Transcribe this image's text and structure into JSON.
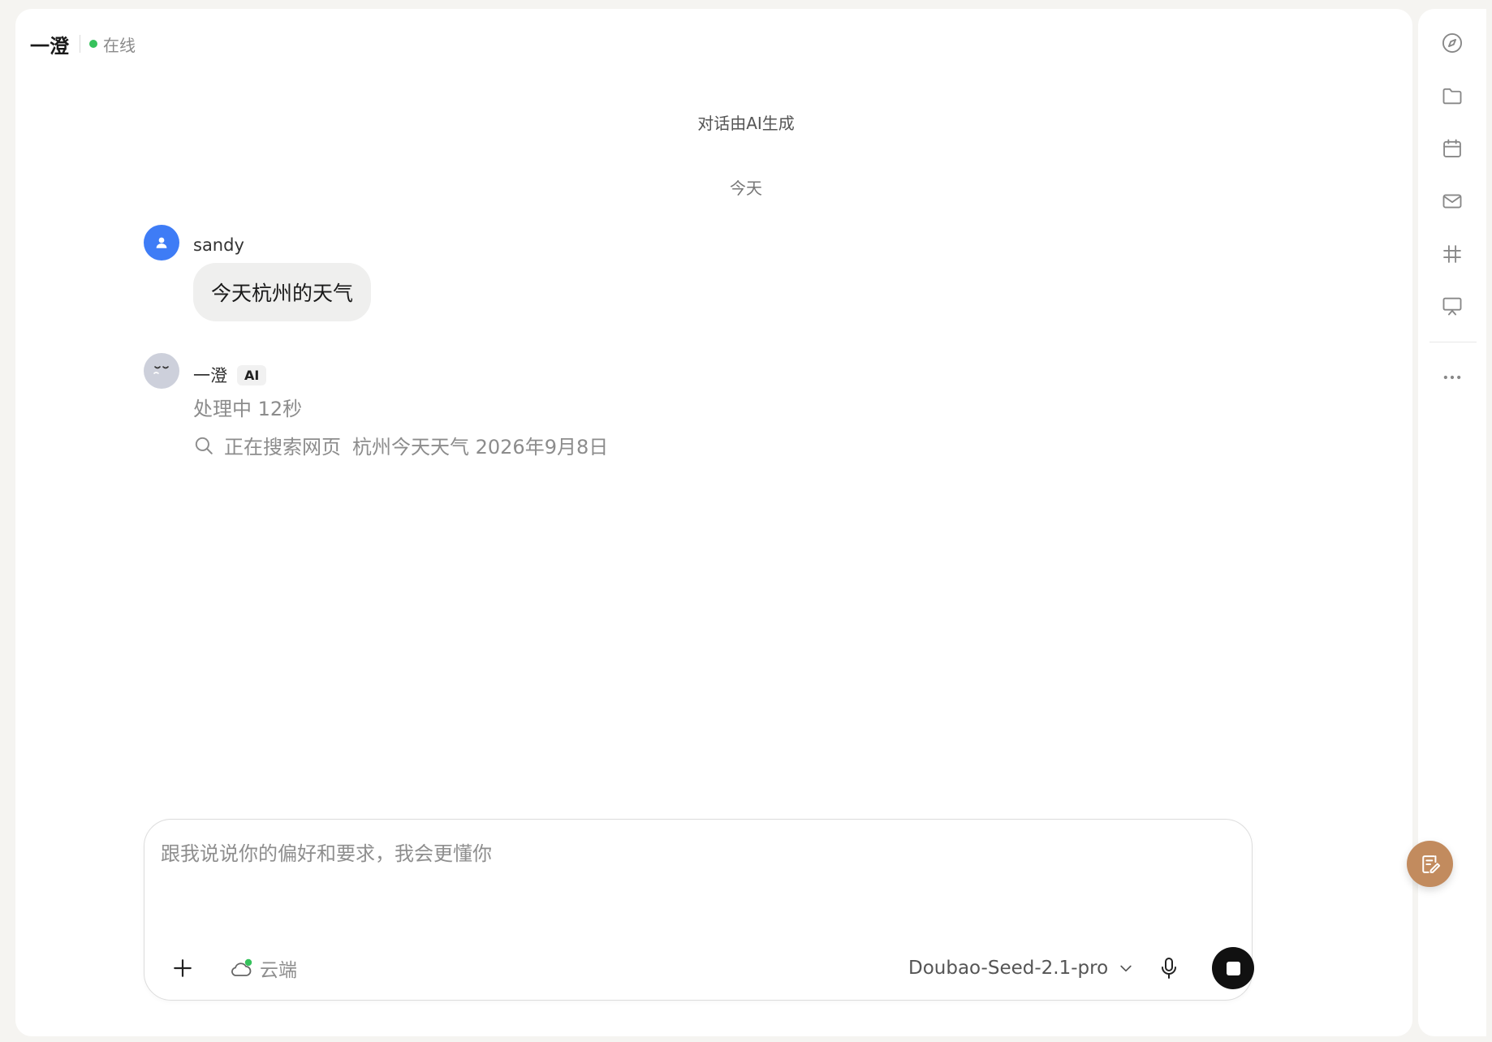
{
  "header": {
    "agent_name": "一澄",
    "status": "在线"
  },
  "notice": "对话由AI生成",
  "day_label": "今天",
  "messages": [
    {
      "sender": "sandy",
      "text": "今天杭州的天气"
    },
    {
      "sender": "一澄",
      "badge": "AI",
      "processing": "处理中 12秒",
      "search_action": "正在搜索网页",
      "search_query": "杭州今天天气 2026年9月8日"
    }
  ],
  "composer": {
    "placeholder": "跟我说说你的偏好和要求，我会更懂你",
    "cloud_label": "云端",
    "model_name": "Doubao-Seed-2.1-pro"
  },
  "rail": {
    "icons": [
      "compass-icon",
      "folder-icon",
      "calendar-icon",
      "mail-icon",
      "hashtag-icon",
      "presentation-icon",
      "more-icon"
    ]
  },
  "colors": {
    "online": "#36c25c",
    "user_avatar": "#3e7cf6",
    "fab": "#c28b5e",
    "stop_button": "#111111"
  }
}
